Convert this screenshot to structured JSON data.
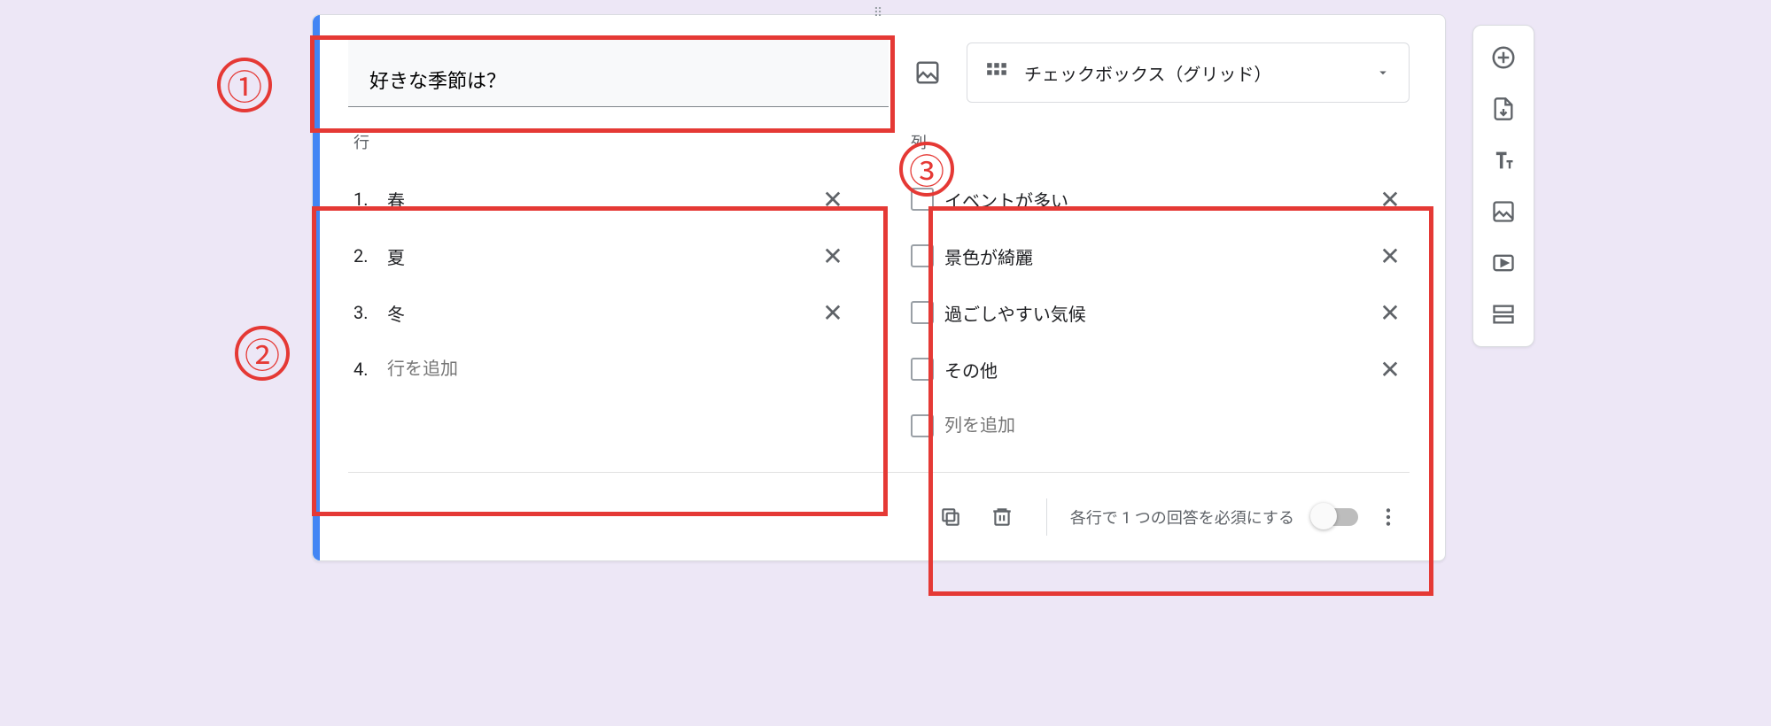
{
  "question": {
    "title": "好きな季節は？",
    "type_label": "チェックボックス（グリッド）"
  },
  "rows": {
    "header": "行",
    "items": [
      "春",
      "夏",
      "冬"
    ],
    "add_placeholder": "行を追加",
    "add_index": "4."
  },
  "columns": {
    "header": "列",
    "items": [
      "イベントが多い",
      "景色が綺麗",
      "過ごしやすい気候",
      "その他"
    ],
    "add_placeholder": "列を追加"
  },
  "footer": {
    "required_label": "各行で 1 つの回答を必須にする"
  },
  "annotations": {
    "one": "①",
    "two": "②",
    "three": "③"
  }
}
